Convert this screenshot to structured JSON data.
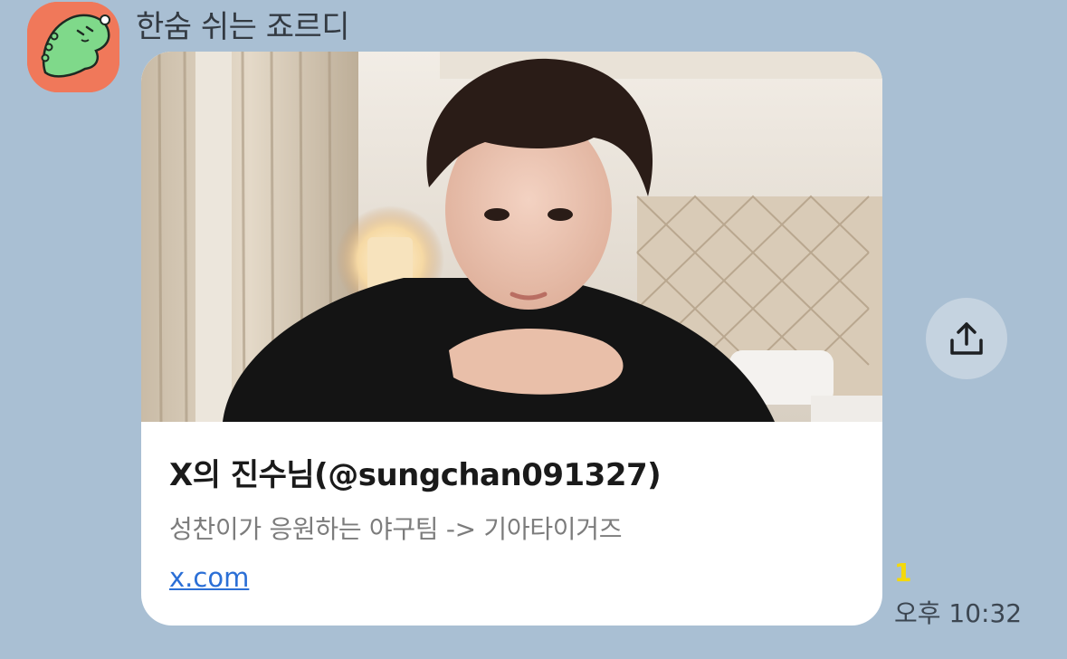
{
  "message": {
    "sender_name": "한숨 쉬는 죠르디",
    "avatar_icon": "green-dinosaur-character-icon",
    "avatar_bg_color": "#f0785a",
    "link_preview": {
      "image_alt": "Photo of a young man in a black top resting his chin on his hands in a hotel room",
      "title": "X의 진수님(@sungchan091327)",
      "description": "성찬이가 응원하는 야구팀 -> 기아타이거즈",
      "domain": "x.com"
    },
    "share_icon": "share-upload-icon",
    "unread_count": "1",
    "timestamp": "오후 10:32"
  },
  "colors": {
    "chat_background": "#a9bfd3",
    "link_color": "#2b6fd6",
    "unread_color": "#f5d90a"
  }
}
